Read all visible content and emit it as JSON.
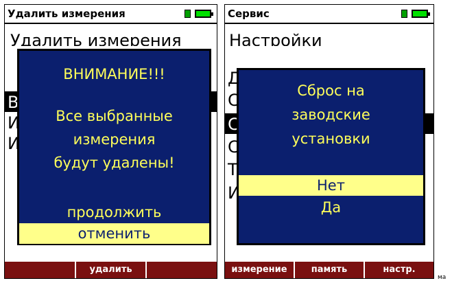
{
  "left_screen": {
    "title": "Удалить измерения",
    "background_lines": [
      "Удалить измерения",
      "В",
      "И",
      "И"
    ],
    "dialog": {
      "heading": "ВНИМАНИЕ!!!",
      "message": [
        "Все выбранные",
        "измерения",
        "будут удалены!"
      ],
      "options": [
        {
          "label": "продолжить",
          "selected": false
        },
        {
          "label": "отменить",
          "selected": true
        }
      ]
    },
    "softkeys": [
      "",
      "удалить",
      ""
    ]
  },
  "right_screen": {
    "title": "Сервис",
    "background_lines": [
      "Настройки",
      "Д",
      "С",
      "С",
      "С",
      "Т",
      "И"
    ],
    "dialog": {
      "message": [
        "Сброс на",
        "заводские",
        "установки"
      ],
      "options": [
        {
          "label": "Нет",
          "selected": true
        },
        {
          "label": "Да",
          "selected": false
        }
      ]
    },
    "softkeys": [
      "измерение",
      "память",
      "настр."
    ]
  },
  "edge_text": "ма",
  "colors": {
    "dialog_bg": "#0b1f6e",
    "dialog_text": "#ffff5a",
    "selected_bg": "#ffff8a",
    "softkey_bar": "#7a1010",
    "battery": "#00e000"
  }
}
